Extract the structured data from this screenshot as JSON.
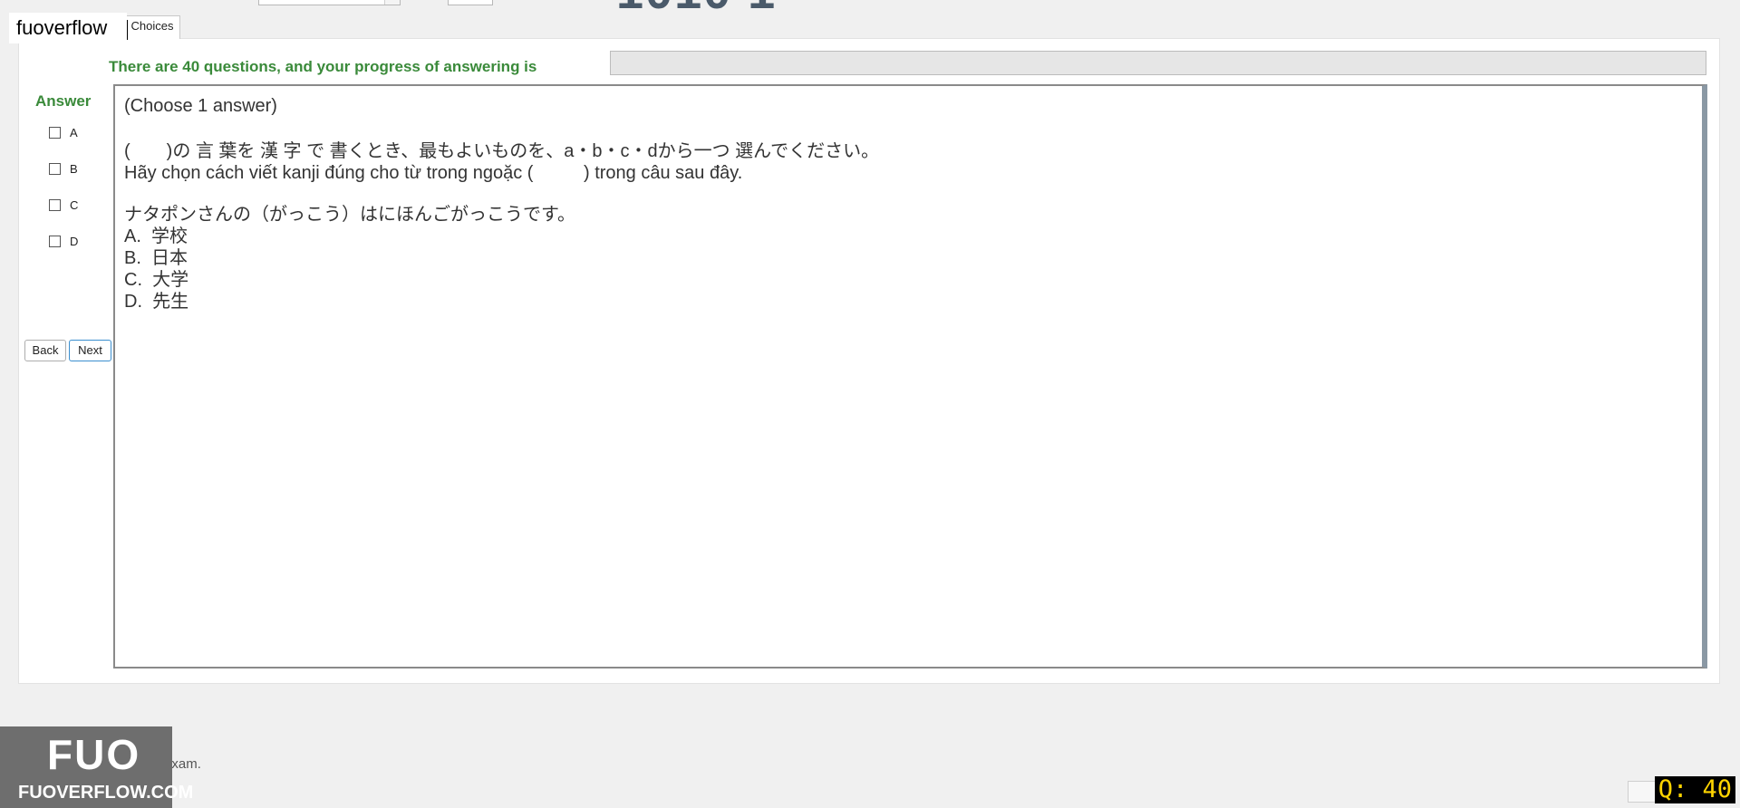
{
  "watermark_top": "fuoverflow",
  "tab_label": "Choices",
  "progress": {
    "label": "There are 40 questions, and your progress of answering is",
    "fraction": 0
  },
  "answer": {
    "label": "Answer",
    "options": [
      "A",
      "B",
      "C",
      "D"
    ]
  },
  "nav": {
    "back": "Back",
    "next": "Next"
  },
  "question": {
    "instruction": "(Choose 1 answer)",
    "prompt_jp": "(　　)の 言 葉を 漢 字 で 書くとき、最もよいものを、a・b・c・dから一つ 選んでください。",
    "prompt_vi": "Hãy chọn cách viết kanji đúng cho từ trong ngoặc (          ) trong câu sau đây.",
    "sentence": "ナタポンさんの（がっこう）はにほんごがっこうです。",
    "choices": [
      "A.  学校",
      "B.  日本",
      "C.  大学",
      "D.  先生"
    ]
  },
  "finish_label": "I want to finish the exam.",
  "logo": {
    "big": "FUO",
    "small": "FUOVERFLOW.COM"
  },
  "question_counter": "Q: 40",
  "colors": {
    "accent_green": "#3a8a3a",
    "counter_yellow": "#ffd400"
  }
}
